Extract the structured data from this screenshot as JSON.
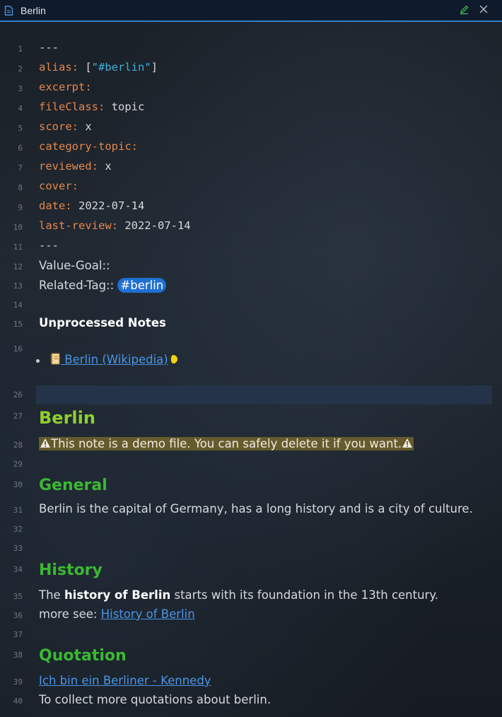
{
  "window": {
    "title": "Berlin",
    "accent": "#2f7fd1"
  },
  "icons": {
    "title_icon": "document-icon",
    "edit_icon": "pencil-icon",
    "close_icon": "close-icon",
    "book_icon": "notebook-icon",
    "status_icon": "half-moon-icon",
    "warning_icon": "warning-icon"
  },
  "line_numbers": {
    "l1": "1",
    "l2": "2",
    "l3": "3",
    "l4": "4",
    "l5": "5",
    "l6": "6",
    "l7": "7",
    "l8": "8",
    "l9": "9",
    "l10": "10",
    "l11": "11",
    "l12": "12",
    "l13": "13",
    "l14": "14",
    "l15": "15",
    "l16": "16",
    "l26": "26",
    "l27": "27",
    "l28": "28",
    "l29": "29",
    "l30": "30",
    "l31": "31",
    "l32": "32",
    "l33": "33",
    "l34": "34",
    "l35": "35",
    "l36": "36",
    "l37": "37",
    "l38": "38",
    "l39": "39",
    "l40": "40"
  },
  "frontmatter": {
    "delimiter": "---",
    "alias_key": "alias:",
    "alias_open": " [",
    "alias_value": "\"#berlin\"",
    "alias_close": "]",
    "excerpt_key": "excerpt:",
    "fileclass_key": "fileClass:",
    "fileclass_value": " topic",
    "score_key": "score:",
    "score_value": " x",
    "category_key": "category-topic:",
    "reviewed_key": "reviewed:",
    "reviewed_value": " x",
    "cover_key": "cover:",
    "date_key": "date:",
    "date_value": " 2022-07-14",
    "lastreview_key": "last-review:",
    "lastreview_value": " 2022-07-14"
  },
  "body": {
    "value_goal": "Value-Goal::",
    "related_tag_label": "Related-Tag:: ",
    "related_tag": "#berlin",
    "unprocessed_heading": "Unprocessed Notes",
    "wiki_link": " Berlin (Wikipedia)",
    "h1": "Berlin",
    "demo_note": "This note is a demo file. You can safely delete it if you want.",
    "general_heading": "General",
    "general_text": "Berlin is the capital of Germany, has a long history and is a city of culture.",
    "history_heading": "History",
    "history_prefix": "The ",
    "history_bold": "history of Berlin",
    "history_suffix": " starts with its foundation in the 13th century.",
    "more_see": "more see: ",
    "history_link": "History of Berlin",
    "quotation_heading": "Quotation",
    "quote_link": "Ich bin ein Berliner - Kennedy",
    "quote_text": "To collect more quotations about berlin."
  }
}
